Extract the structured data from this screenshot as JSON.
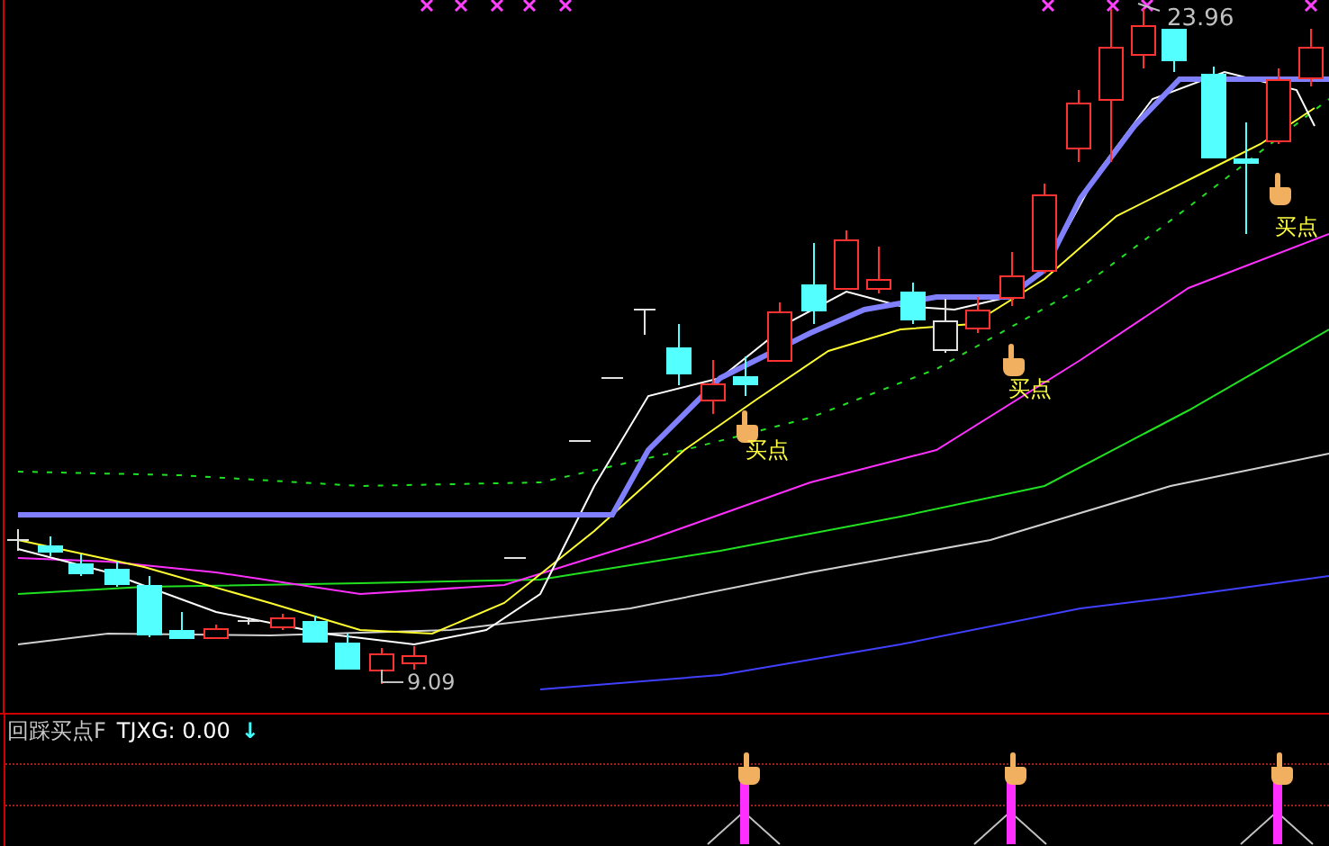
{
  "main_chart": {
    "high_label": "23.96",
    "low_label": "9.09",
    "signals": [
      {
        "label": "买点"
      },
      {
        "label": "买点"
      },
      {
        "label": "买点"
      }
    ]
  },
  "indicator_panel": {
    "title": "回踩买点F",
    "readout": "TJXG: 0.00",
    "arrow": "↓"
  }
}
